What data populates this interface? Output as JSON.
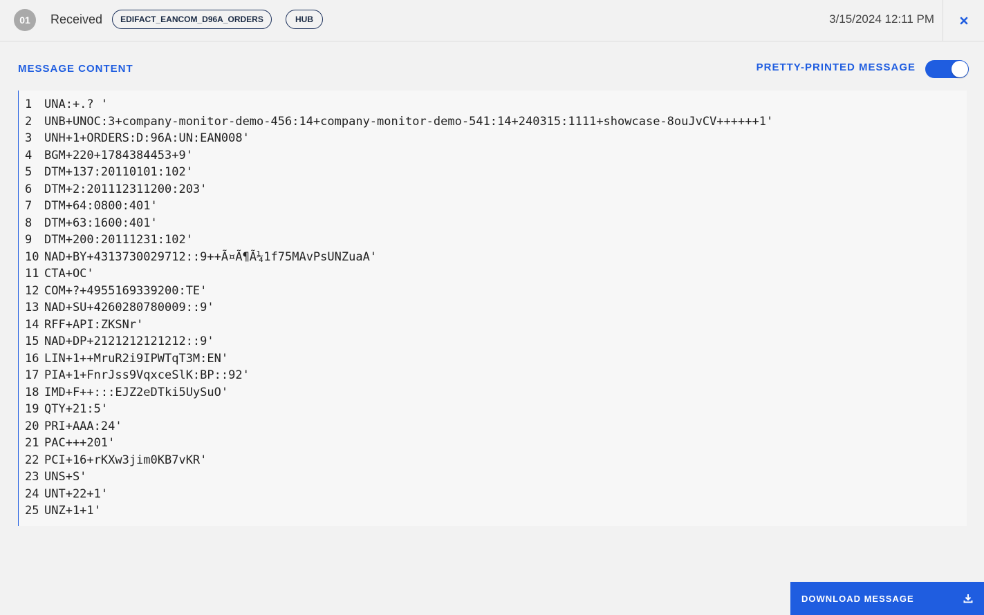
{
  "header": {
    "step_number": "01",
    "status": "Received",
    "tags": [
      "EDIFACT_EANCOM_D96A_ORDERS",
      "HUB"
    ],
    "timestamp": "3/15/2024 12:11 PM",
    "close_icon": "close-icon"
  },
  "content": {
    "section_title": "MESSAGE CONTENT",
    "toggle_label": "PRETTY-PRINTED MESSAGE",
    "toggle_on": true,
    "lines": [
      {
        "n": "1",
        "text": "UNA:+.? '"
      },
      {
        "n": "2",
        "text": "UNB+UNOC:3+company-monitor-demo-456:14+company-monitor-demo-541:14+240315:1111+showcase-8ouJvCV++++++1'"
      },
      {
        "n": "3",
        "text": "UNH+1+ORDERS:D:96A:UN:EAN008'"
      },
      {
        "n": "4",
        "text": "BGM+220+1784384453+9'"
      },
      {
        "n": "5",
        "text": "DTM+137:20110101:102'"
      },
      {
        "n": "6",
        "text": "DTM+2:201112311200:203'"
      },
      {
        "n": "7",
        "text": "DTM+64:0800:401'"
      },
      {
        "n": "8",
        "text": "DTM+63:1600:401'"
      },
      {
        "n": "9",
        "text": "DTM+200:20111231:102'"
      },
      {
        "n": "10",
        "text": "NAD+BY+4313730029712::9++Ã¤Ã¶Ã¼1f75MAvPsUNZuaA'"
      },
      {
        "n": "11",
        "text": "CTA+OC'"
      },
      {
        "n": "12",
        "text": "COM+?+4955169339200:TE'"
      },
      {
        "n": "13",
        "text": "NAD+SU+4260280780009::9'"
      },
      {
        "n": "14",
        "text": "RFF+API:ZKSNr'"
      },
      {
        "n": "15",
        "text": "NAD+DP+2121212121212::9'"
      },
      {
        "n": "16",
        "text": "LIN+1++MruR2i9IPWTqT3M:EN'"
      },
      {
        "n": "17",
        "text": "PIA+1+FnrJss9VqxceSlK:BP::92'"
      },
      {
        "n": "18",
        "text": "IMD+F++:::EJZ2eDTki5UySuO'"
      },
      {
        "n": "19",
        "text": "QTY+21:5'"
      },
      {
        "n": "20",
        "text": "PRI+AAA:24'"
      },
      {
        "n": "21",
        "text": "PAC+++201'"
      },
      {
        "n": "22",
        "text": "PCI+16+rKXw3jim0KB7vKR'"
      },
      {
        "n": "23",
        "text": "UNS+S'"
      },
      {
        "n": "24",
        "text": "UNT+22+1'"
      },
      {
        "n": "25",
        "text": "UNZ+1+1'"
      }
    ]
  },
  "footer": {
    "download_label": "DOWNLOAD MESSAGE",
    "download_icon": "download-icon"
  },
  "colors": {
    "accent": "#1f5de0",
    "badge_gray": "#a9a9a9",
    "tag_border": "#1a2f5a"
  }
}
